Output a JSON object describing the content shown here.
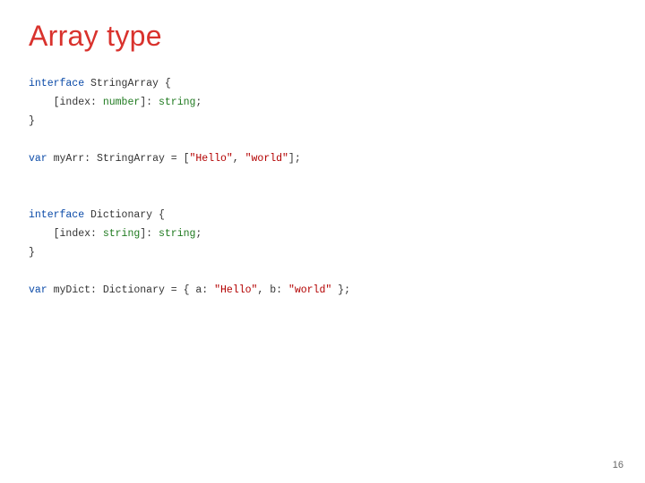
{
  "title": "Array type",
  "code": {
    "k_interface": "interface",
    "k_var": "var",
    "t_number": "number",
    "t_string": "string",
    "name_stringarray": "StringArray",
    "name_dictionary": "Dictionary",
    "id_myarr": "myArr",
    "id_mydict": "myDict",
    "id_index": "index",
    "id_a": "a",
    "id_b": "b",
    "s_hello": "\"Hello\"",
    "s_world": "\"world\"",
    "open_brace": " {",
    "close_brace": "}",
    "indent": "    [",
    "col_sp": ": ",
    "br_cl_col_sp": "]: ",
    "semi": ";",
    "eq_br": " = [",
    "com_sp": ", ",
    "br_semi": "];",
    "eq_obr": " = { ",
    "cbr_semi": " };"
  },
  "pagenum": "16"
}
